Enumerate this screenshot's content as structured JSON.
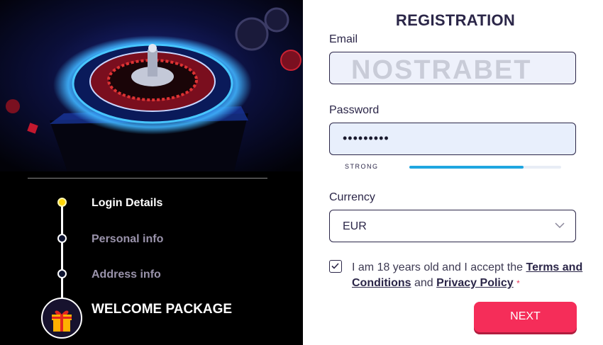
{
  "steps": {
    "items": [
      {
        "label": "Login Details"
      },
      {
        "label": "Personal info"
      },
      {
        "label": "Address info"
      }
    ],
    "welcome": "WELCOME PACKAGE"
  },
  "form": {
    "title": "REGISTRATION",
    "email_label": "Email",
    "email_watermark": "NOSTRABET",
    "password_label": "Password",
    "password_value": "•••••••••",
    "strength_label": "STRONG",
    "strength_fraction": 0.75,
    "currency_label": "Currency",
    "currency_value": "EUR",
    "terms_prefix": "I am 18 years old and I accept the ",
    "terms_link": "Terms and Conditions",
    "terms_and": " and ",
    "privacy_link": "Privacy Policy",
    "required_mark": "*",
    "next_label": "NEXT"
  },
  "colors": {
    "accent": "#f52d59",
    "active_step": "#ffd60a",
    "strength": "#1fa6e0",
    "text_dark": "#2b2648"
  }
}
